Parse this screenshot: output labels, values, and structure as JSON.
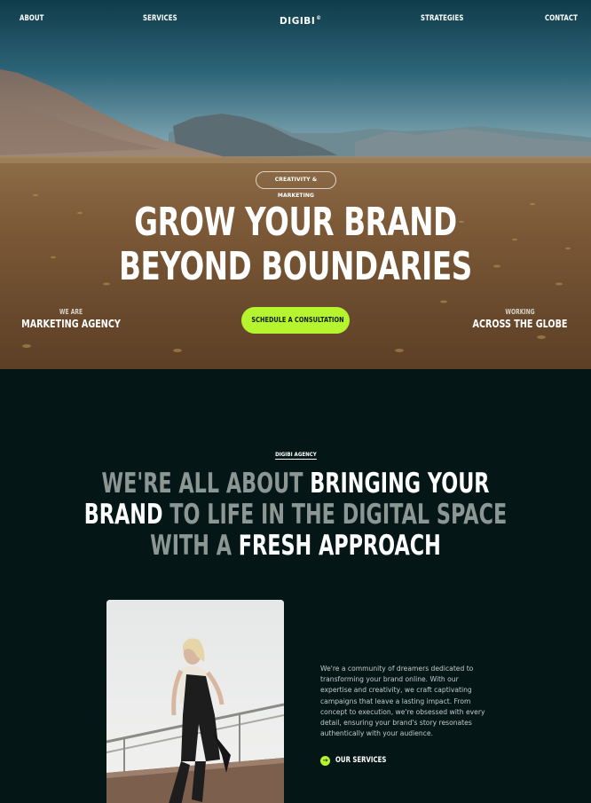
{
  "nav": {
    "about": "ABOUT",
    "services": "SERVICES",
    "logo": "DIGIBI",
    "logo_mark": "©",
    "strategies": "STRATEGIES",
    "contact": "CONTACT"
  },
  "hero": {
    "tag": "CREATIVITY & MARKETING",
    "headline_line1": "GROW YOUR BRAND",
    "headline_line2": "BEYOND BOUNDARIES",
    "left_small": "WE ARE",
    "left_big": "MARKETING AGENCY",
    "cta_label": "SCHEDULE A CONSULTATION",
    "right_small": "WORKING",
    "right_big": "ACROSS THE GLOBE"
  },
  "about": {
    "tag": "DIGIBI AGENCY",
    "statement": {
      "l1_dim": "WE'RE ALL ABOUT ",
      "l1_bright": "BRINGING YOUR",
      "l2_bright": "BRAND ",
      "l2_dim": "TO LIFE IN THE DIGITAL SPACE",
      "l3_dim": "WITH A ",
      "l3_bright": "FRESH APPROACH"
    },
    "description": "We're a community of dreamers dedicated to transforming your brand online. With our expertise and creativity, we craft captivating campaigns that leave a lasting impact. From concept to execution, we're obsessed with every detail, ensuring your brand's story resonates authentically with your audience.",
    "services_link": "OUR SERVICES",
    "services_icon": "arrow-right-icon"
  },
  "colors": {
    "accent": "#b6f52e",
    "dark_bg": "#041716",
    "dim_text": "#8c9794"
  }
}
